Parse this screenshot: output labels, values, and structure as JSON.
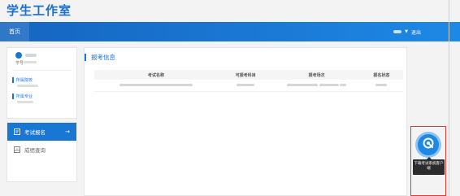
{
  "app": {
    "title": "学生工作室"
  },
  "nav": {
    "home_tab": "首页",
    "logout": "退出"
  },
  "profile": {
    "student_no_label": "学号",
    "college_label": "所属院校",
    "major_label": "所属专业"
  },
  "menu": {
    "items": [
      {
        "label": "考试报名",
        "active": true
      },
      {
        "label": "成绩查询",
        "active": false
      }
    ]
  },
  "main": {
    "title": "报考信息",
    "table": {
      "headers": [
        "考试名称",
        "可报考科目",
        "报考场次",
        "报名状态"
      ]
    }
  },
  "widget": {
    "tooltip": "下载考试系统客户端"
  },
  "colors": {
    "primary": "#1976d2",
    "highlight_border": "#e53935"
  }
}
